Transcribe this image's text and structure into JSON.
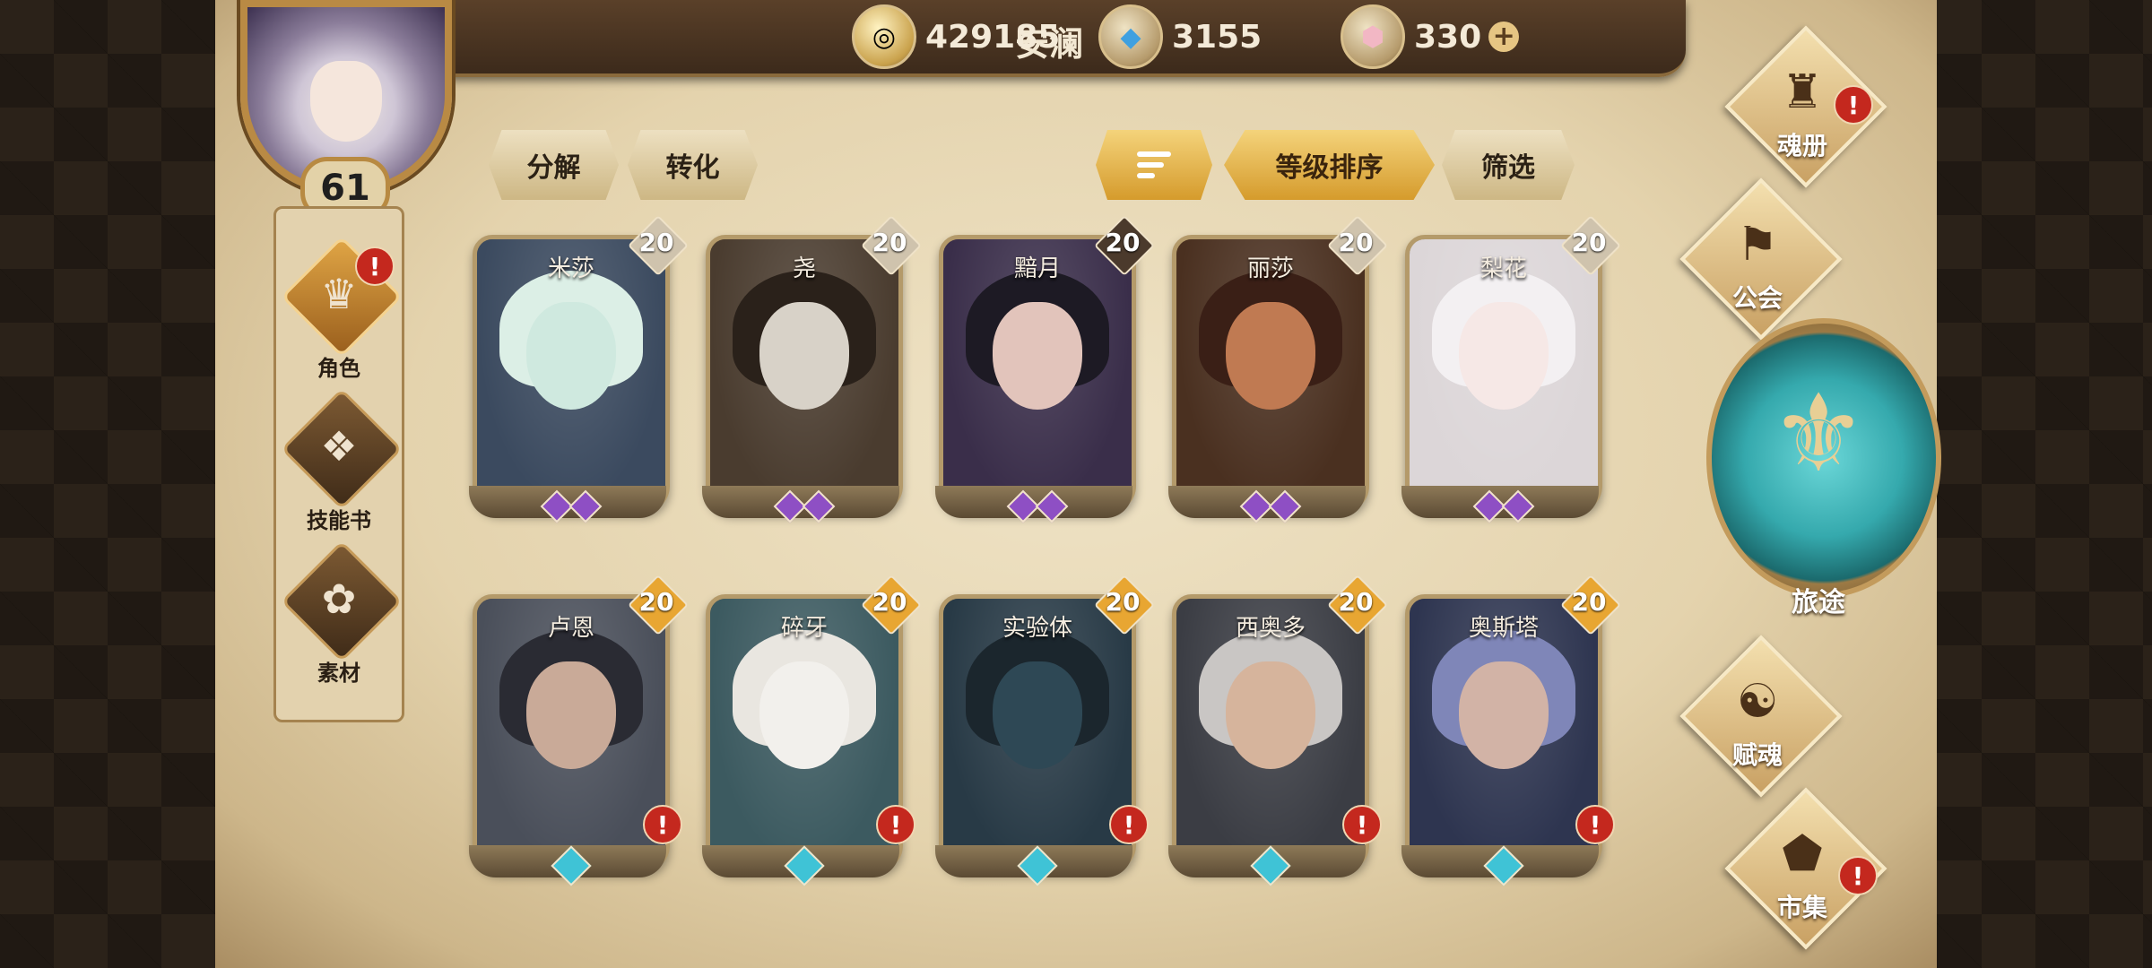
{
  "player": {
    "name": "安澜",
    "level": "61"
  },
  "resources": [
    {
      "icon": "gold-coin-icon",
      "value": "429185"
    },
    {
      "icon": "blue-crystal-icon",
      "value": "3155"
    },
    {
      "icon": "pink-gem-icon",
      "value": "330",
      "plus": "+"
    }
  ],
  "actions": {
    "decompose": "分解",
    "convert": "转化",
    "sort_level": "等级排序",
    "filter": "筛选"
  },
  "left_nav": [
    {
      "label": "角色",
      "glyph": "♛",
      "active": true,
      "alert": "!"
    },
    {
      "label": "技能书",
      "glyph": "❖",
      "active": false
    },
    {
      "label": "素材",
      "glyph": "✿",
      "active": false
    }
  ],
  "cards": [
    {
      "name": "米莎",
      "level": "20",
      "rarity": "purple"
    },
    {
      "name": "尧",
      "level": "20",
      "rarity": "purple"
    },
    {
      "name": "黯月",
      "level": "20",
      "rarity": "purple"
    },
    {
      "name": "丽莎",
      "level": "20",
      "rarity": "purple"
    },
    {
      "name": "梨花",
      "level": "20",
      "rarity": "purple"
    },
    {
      "name": "卢恩",
      "level": "20",
      "rarity": "blue",
      "alert": "!"
    },
    {
      "name": "碎牙",
      "level": "20",
      "rarity": "blue",
      "alert": "!"
    },
    {
      "name": "实验体",
      "level": "20",
      "rarity": "blue",
      "alert": "!"
    },
    {
      "name": "西奥多",
      "level": "20",
      "rarity": "blue",
      "alert": "!"
    },
    {
      "name": "奥斯塔",
      "level": "20",
      "rarity": "blue",
      "alert": "!"
    }
  ],
  "right_nav": [
    {
      "label": "魂册",
      "glyph": "♜",
      "alert": "!"
    },
    {
      "label": "公会",
      "glyph": "⚑"
    },
    {
      "label": "旅途",
      "glyph": "⚜"
    },
    {
      "label": "赋魂",
      "glyph": "☯"
    },
    {
      "label": "市集",
      "glyph": "⬟",
      "alert": "!"
    }
  ],
  "colors": {
    "gold": "#d59b2c",
    "purple_gem": "#8e4fc4",
    "blue_gem": "#3fc3d6",
    "alert": "#c4281e"
  }
}
